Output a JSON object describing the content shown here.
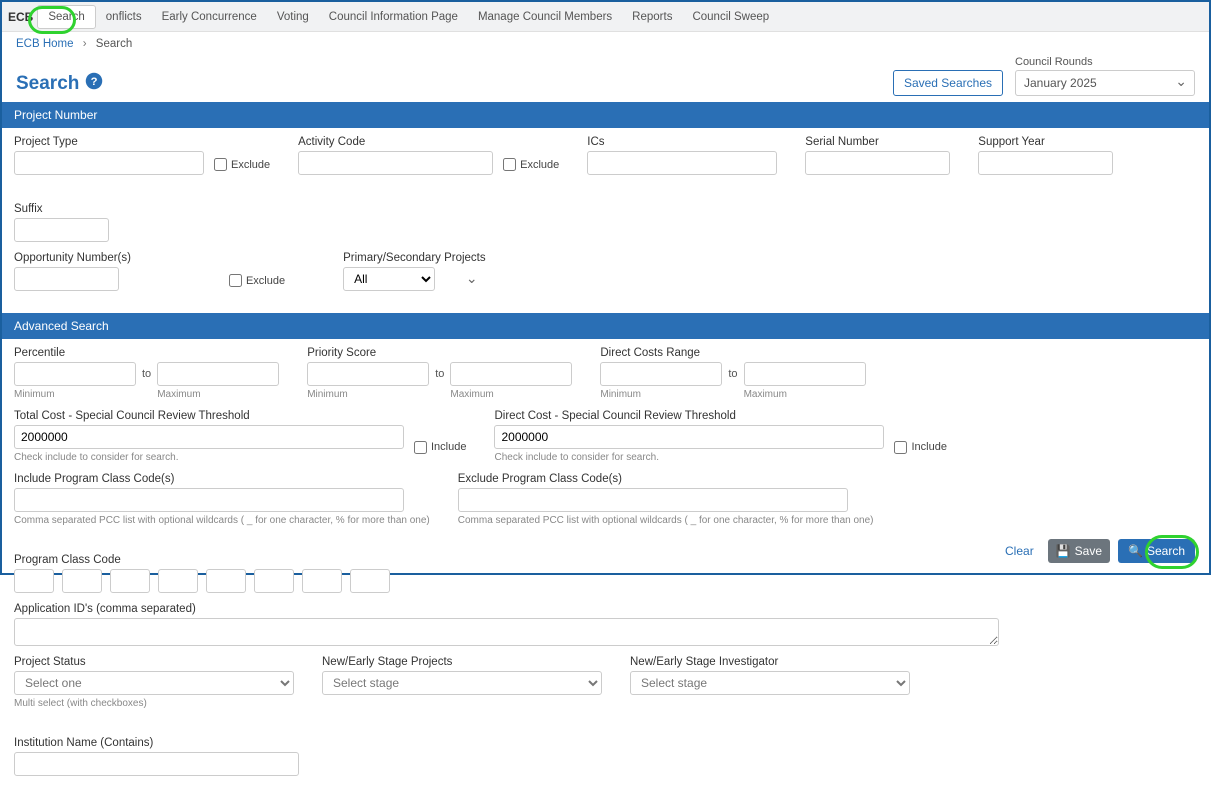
{
  "nav": {
    "brand": "ECB",
    "items": [
      "Search",
      "onflicts",
      "Early Concurrence",
      "Voting",
      "Council Information Page",
      "Manage Council Members",
      "Reports",
      "Council Sweep"
    ],
    "active": "Search"
  },
  "breadcrumb": {
    "root": "ECB Home",
    "current": "Search"
  },
  "title": "Search",
  "saved_searches": "Saved Searches",
  "council_rounds": {
    "label": "Council Rounds",
    "value": "January 2025"
  },
  "sections": {
    "project_number": "Project Number",
    "advanced": "Advanced Search"
  },
  "pn": {
    "project_type": "Project Type",
    "activity_code": "Activity Code",
    "ics": "ICs",
    "serial_number": "Serial Number",
    "support_year": "Support Year",
    "suffix": "Suffix",
    "opportunity": "Opportunity Number(s)",
    "primary_secondary": "Primary/Secondary Projects",
    "primary_secondary_value": "All",
    "exclude": "Exclude"
  },
  "adv": {
    "percentile": "Percentile",
    "priority": "Priority Score",
    "direct_costs": "Direct Costs Range",
    "to": "to",
    "min": "Minimum",
    "max": "Maximum",
    "total_cost_thr": "Total Cost - Special Council Review Threshold",
    "direct_cost_thr": "Direct Cost - Special Council Review Threshold",
    "thr_value": "2000000",
    "thr_hint": "Check include to consider for search.",
    "include": "Include",
    "include_pcc": "Include Program Class Code(s)",
    "exclude_pcc": "Exclude Program Class Code(s)",
    "pcc_label": "Program Class Code",
    "pcc_hint": "Comma separated PCC list with optional wildcards ( _ for one character, % for more than one)",
    "app_ids": "Application ID's (comma separated)",
    "project_status": "Project Status",
    "select_one": "Select one",
    "multi_hint": "Multi select (with checkboxes)",
    "new_early_proj": "New/Early Stage Projects",
    "new_early_inv": "New/Early Stage Investigator",
    "select_stage": "Select stage",
    "inst_name": "Institution Name (Contains)"
  },
  "footer": {
    "clear": "Clear",
    "save": "Save",
    "search": "Search"
  }
}
